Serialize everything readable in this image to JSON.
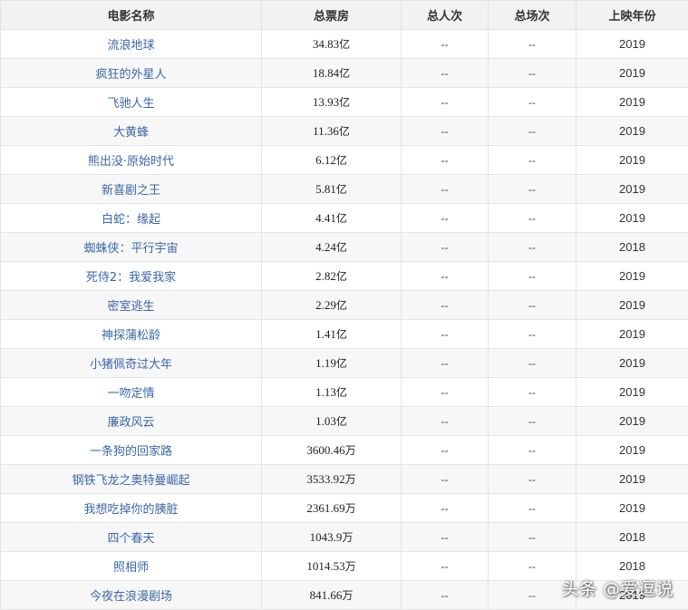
{
  "table": {
    "headers": [
      "电影名称",
      "总票房",
      "总人次",
      "总场次",
      "上映年份"
    ],
    "rows": [
      {
        "title": "流浪地球",
        "gross": "34.83",
        "unit": "亿",
        "viewers": "--",
        "screenings": "--",
        "year": "2019"
      },
      {
        "title": "疯狂的外星人",
        "gross": "18.84",
        "unit": "亿",
        "viewers": "--",
        "screenings": "--",
        "year": "2019"
      },
      {
        "title": "飞驰人生",
        "gross": "13.93",
        "unit": "亿",
        "viewers": "--",
        "screenings": "--",
        "year": "2019"
      },
      {
        "title": "大黄蜂",
        "gross": "11.36",
        "unit": "亿",
        "viewers": "--",
        "screenings": "--",
        "year": "2019"
      },
      {
        "title": "熊出没·原始时代",
        "gross": "6.12",
        "unit": "亿",
        "viewers": "--",
        "screenings": "--",
        "year": "2019"
      },
      {
        "title": "新喜剧之王",
        "gross": "5.81",
        "unit": "亿",
        "viewers": "--",
        "screenings": "--",
        "year": "2019"
      },
      {
        "title": "白蛇：缘起",
        "gross": "4.41",
        "unit": "亿",
        "viewers": "--",
        "screenings": "--",
        "year": "2019"
      },
      {
        "title": "蜘蛛侠：平行宇宙",
        "gross": "4.24",
        "unit": "亿",
        "viewers": "--",
        "screenings": "--",
        "year": "2018"
      },
      {
        "title": "死侍2：我爱我家",
        "gross": "2.82",
        "unit": "亿",
        "viewers": "--",
        "screenings": "--",
        "year": "2019"
      },
      {
        "title": "密室逃生",
        "gross": "2.29",
        "unit": "亿",
        "viewers": "--",
        "screenings": "--",
        "year": "2019"
      },
      {
        "title": "神探蒲松龄",
        "gross": "1.41",
        "unit": "亿",
        "viewers": "--",
        "screenings": "--",
        "year": "2019"
      },
      {
        "title": "小猪佩奇过大年",
        "gross": "1.19",
        "unit": "亿",
        "viewers": "--",
        "screenings": "--",
        "year": "2019"
      },
      {
        "title": "一吻定情",
        "gross": "1.13",
        "unit": "亿",
        "viewers": "--",
        "screenings": "--",
        "year": "2019"
      },
      {
        "title": "廉政风云",
        "gross": "1.03",
        "unit": "亿",
        "viewers": "--",
        "screenings": "--",
        "year": "2019"
      },
      {
        "title": "一条狗的回家路",
        "gross": "3600.46",
        "unit": "万",
        "viewers": "--",
        "screenings": "--",
        "year": "2019"
      },
      {
        "title": "钢铁飞龙之奥特曼崛起",
        "gross": "3533.92",
        "unit": "万",
        "viewers": "--",
        "screenings": "--",
        "year": "2019"
      },
      {
        "title": "我想吃掉你的胰脏",
        "gross": "2361.69",
        "unit": "万",
        "viewers": "--",
        "screenings": "--",
        "year": "2019"
      },
      {
        "title": "四个春天",
        "gross": "1043.9",
        "unit": "万",
        "viewers": "--",
        "screenings": "--",
        "year": "2018"
      },
      {
        "title": "照相师",
        "gross": "1014.53",
        "unit": "万",
        "viewers": "--",
        "screenings": "--",
        "year": "2018"
      },
      {
        "title": "今夜在浪漫剧场",
        "gross": "841.66",
        "unit": "万",
        "viewers": "--",
        "screenings": "--",
        "year": "2019"
      }
    ]
  },
  "watermark": "头条 @爱逗说"
}
